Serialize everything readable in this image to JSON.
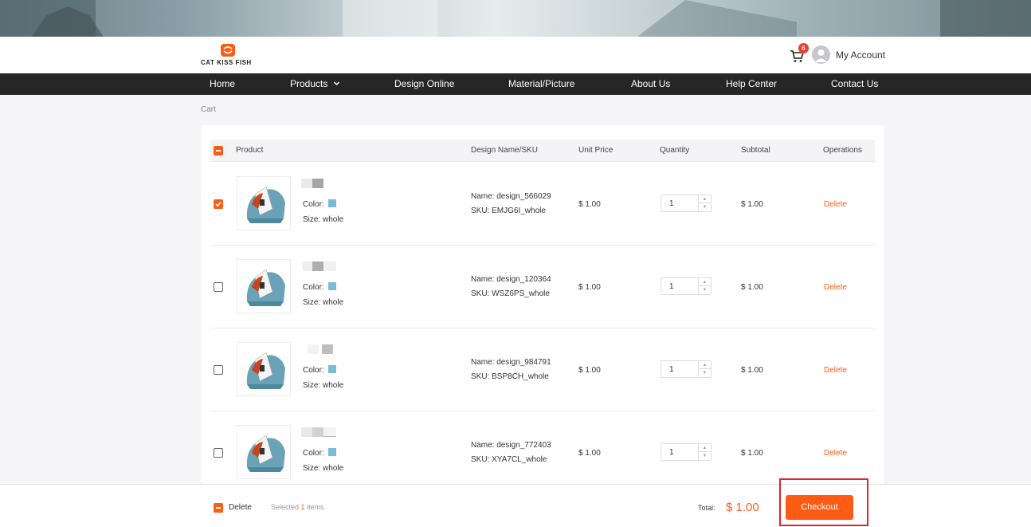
{
  "brand": {
    "logo_text": "CAT KISS FISH",
    "accent": "#fe5c15"
  },
  "header": {
    "cart_count": "6",
    "account_label": "My Account"
  },
  "nav": {
    "items": [
      "Home",
      "Products",
      "Design Online",
      "Material/Picture",
      "About Us",
      "Help Center",
      "Contact Us"
    ]
  },
  "breadcrumb": "Cart",
  "table": {
    "headers": {
      "product": "Product",
      "design": "Design Name/SKU",
      "unit_price": "Unit Price",
      "quantity": "Quantity",
      "subtotal": "Subtotal",
      "operations": "Operations"
    },
    "rows": [
      {
        "selected": true,
        "color_label": "Color:",
        "size": "Size: whole",
        "design_name": "Name:  design_566029",
        "sku": "SKU:  EMJG6I_whole",
        "unit_price": "$ 1.00",
        "quantity": "1",
        "subtotal": "$ 1.00",
        "delete_label": "Delete"
      },
      {
        "selected": false,
        "color_label": "Color:",
        "size": "Size: whole",
        "design_name": "Name:  design_120364",
        "sku": "SKU:  WSZ6PS_whole",
        "unit_price": "$ 1.00",
        "quantity": "1",
        "subtotal": "$ 1.00",
        "delete_label": "Delete"
      },
      {
        "selected": false,
        "color_label": "Color:",
        "size": "Size: whole",
        "design_name": "Name:  design_984791",
        "sku": "SKU:  BSP8CH_whole",
        "unit_price": "$ 1.00",
        "quantity": "1",
        "subtotal": "$ 1.00",
        "delete_label": "Delete"
      },
      {
        "selected": false,
        "color_label": "Color:",
        "size": "Size: whole",
        "design_name": "Name:  design_772403",
        "sku": "SKU:  XYA7CL_whole",
        "unit_price": "$ 1.00",
        "quantity": "1",
        "subtotal": "$ 1.00",
        "delete_label": "Delete"
      }
    ]
  },
  "footer": {
    "delete_label": "Delete",
    "selected_prefix": "Selected",
    "selected_count": "1",
    "selected_suffix": "items",
    "total_label": "Total:",
    "total_amount": "$ 1.00",
    "checkout_label": "Checkout"
  },
  "colors": {
    "swatch": "#7dbad4",
    "highlight": "#e0242b"
  }
}
